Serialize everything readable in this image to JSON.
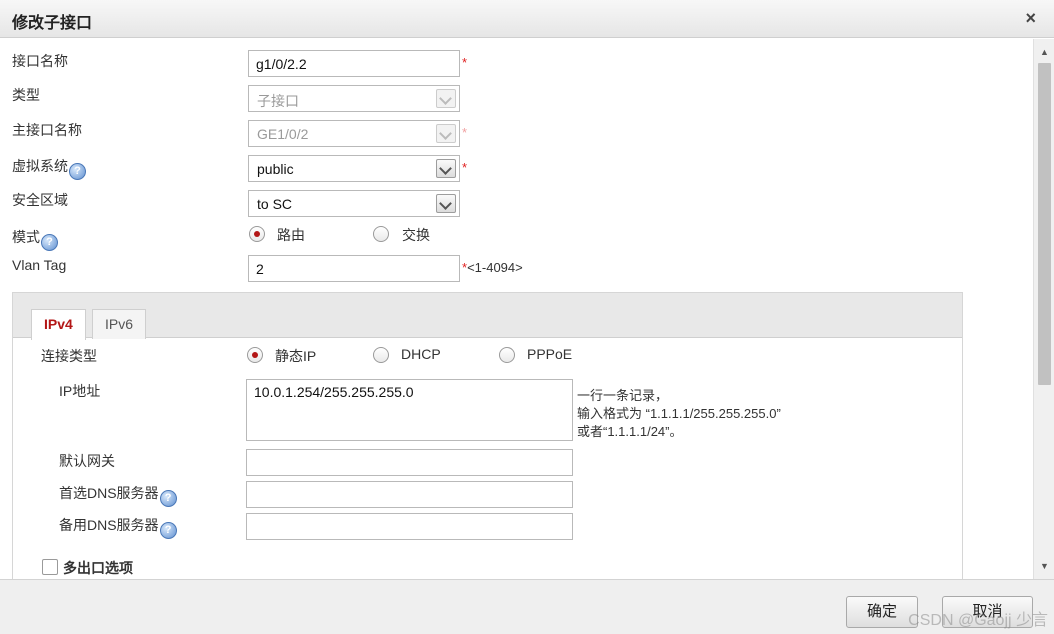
{
  "dialog": {
    "title": "修改子接口",
    "close_glyph": "×"
  },
  "form": {
    "interface_name": {
      "label": "接口名称",
      "value": "g1/0/2.2",
      "required_mark": "*"
    },
    "type": {
      "label": "类型",
      "value": "子接口"
    },
    "parent_interface": {
      "label": "主接口名称",
      "value": "GE1/0/2",
      "required_mark": "*"
    },
    "virtual_system": {
      "label": "虚拟系统",
      "value": "public",
      "required_mark": "*"
    },
    "security_zone": {
      "label": "安全区域",
      "value": "to SC"
    },
    "mode": {
      "label": "模式",
      "options": [
        "路由",
        "交换"
      ],
      "selected": "路由"
    },
    "vlan_tag": {
      "label": "Vlan Tag",
      "value": "2",
      "required_mark": "*",
      "range_hint": "<1-4094>"
    }
  },
  "help_glyph": "?",
  "tabs": [
    {
      "label": "IPv4",
      "active": true
    },
    {
      "label": "IPv6",
      "active": false
    }
  ],
  "ipv4": {
    "connection_type": {
      "label": "连接类型",
      "options": [
        "静态IP",
        "DHCP",
        "PPPoE"
      ],
      "selected": "静态IP"
    },
    "ip_address": {
      "label": "IP地址",
      "value": "10.0.1.254/255.255.255.0",
      "hint_lines": [
        "一行一条记录，",
        "输入格式为 “1.1.1.1/255.255.255.0”",
        "或者“1.1.1.1/24”。"
      ]
    },
    "default_gateway": {
      "label": "默认网关",
      "value": ""
    },
    "primary_dns": {
      "label": "首选DNS服务器",
      "value": ""
    },
    "backup_dns": {
      "label": "备用DNS服务器",
      "value": ""
    },
    "multi_egress": {
      "label": "多出口选项",
      "checked": false
    }
  },
  "scrollbar": {
    "up": "▲",
    "down": "▼"
  },
  "footer": {
    "ok_label": "确定",
    "cancel_label": "取消",
    "watermark": "CSDN @Gaojj 少言"
  },
  "colors": {
    "accent": "#b31616",
    "required": "#e02020"
  }
}
